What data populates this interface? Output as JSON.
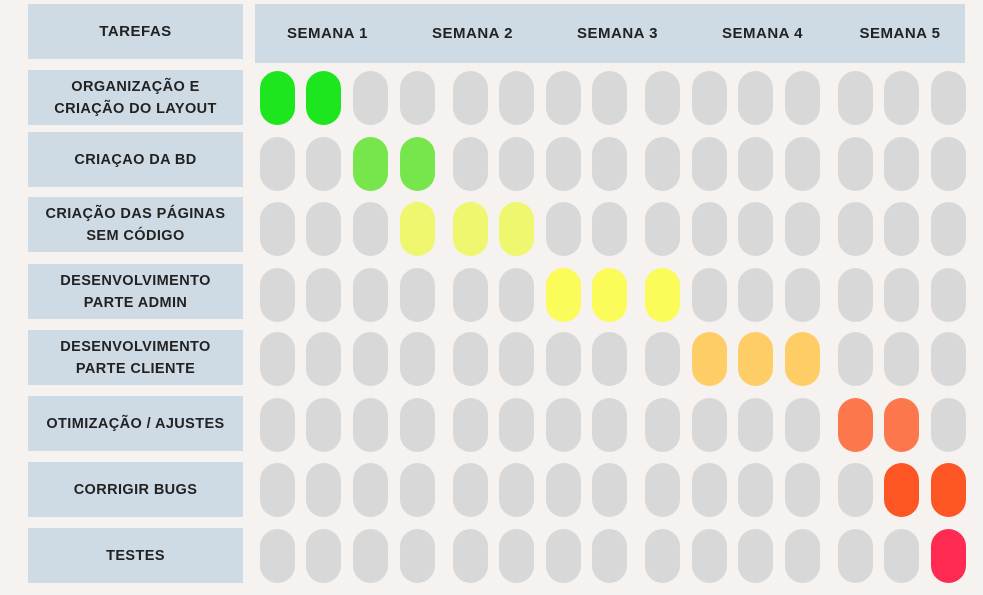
{
  "header": {
    "tasks_label": "TAREFAS",
    "weeks": [
      "SEMANA 1",
      "SEMANA 2",
      "SEMANA 3",
      "SEMANA 4",
      "SEMANA 5"
    ]
  },
  "tasks": [
    {
      "label": "ORGANIZAÇÃO E CRIAÇÃO DO LAYOUT",
      "active_slots": [
        0,
        1
      ],
      "color": "#1ee61e"
    },
    {
      "label": "CRIAÇAO DA BD",
      "active_slots": [
        2,
        3
      ],
      "color": "#77e64d"
    },
    {
      "label": "CRIAÇÃO DAS PÁGINAS SEM CÓDIGO",
      "active_slots": [
        3,
        4,
        5
      ],
      "color": "#eef76e"
    },
    {
      "label": "DESENVOLVIMENTO PARTE ADMIN",
      "active_slots": [
        6,
        7,
        8
      ],
      "color": "#fbfb59"
    },
    {
      "label": "DESENVOLVIMENTO PARTE CLIENTE",
      "active_slots": [
        9,
        10,
        11
      ],
      "color": "#fecd66"
    },
    {
      "label": "OTIMIZAÇÃO / AJUSTES",
      "active_slots": [
        12,
        13
      ],
      "color": "#fd774d"
    },
    {
      "label": "CORRIGIR BUGS",
      "active_slots": [
        13,
        14
      ],
      "color": "#fd5523"
    },
    {
      "label": "TESTES",
      "active_slots": [
        14
      ],
      "color": "#fe2a52"
    }
  ],
  "slot_count": 15,
  "inactive_color": "#d8d8d8",
  "header_color": "#cfdbe4"
}
